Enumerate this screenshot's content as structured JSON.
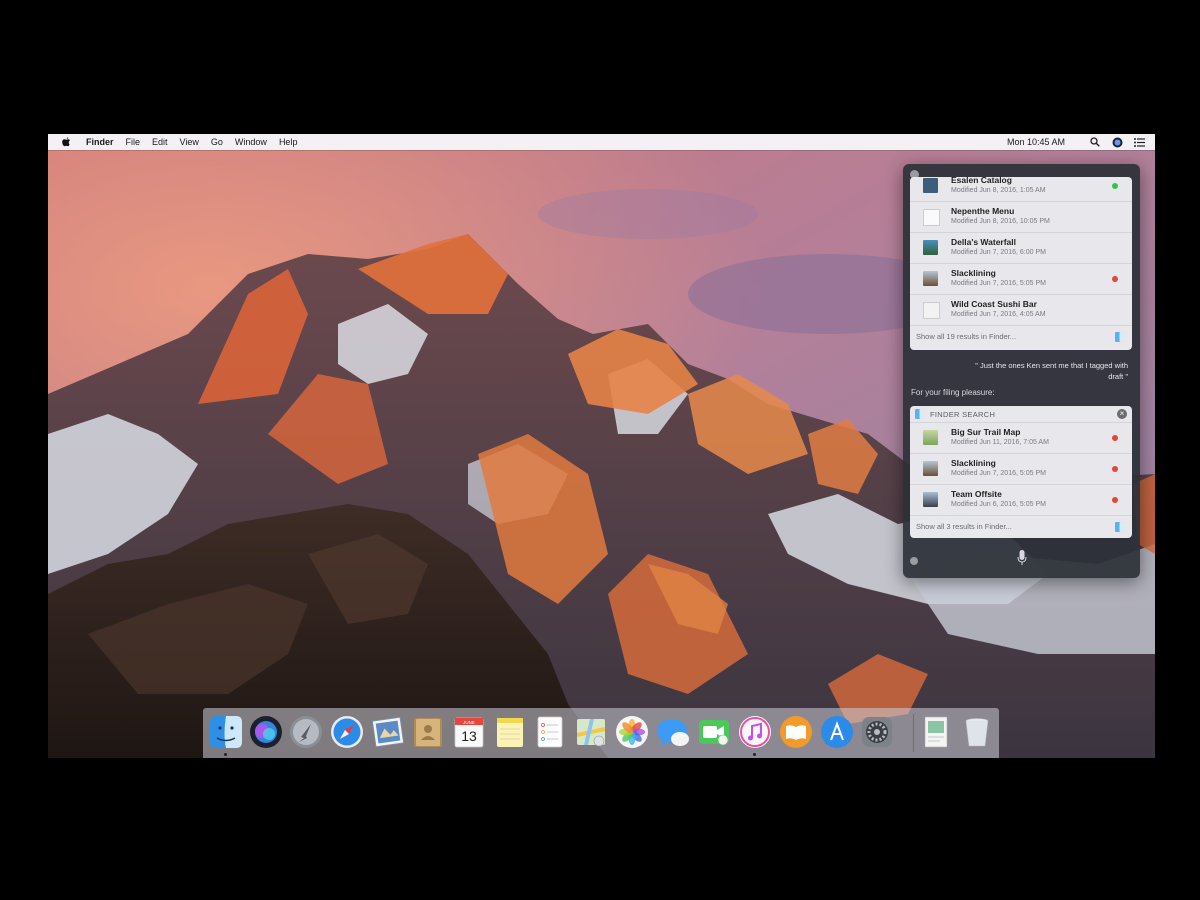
{
  "menubar": {
    "items": [
      "Finder",
      "File",
      "Edit",
      "View",
      "Go",
      "Window",
      "Help"
    ],
    "clock": "Mon 10:45 AM"
  },
  "siri": {
    "recent_results": [
      {
        "name": "Esalen Catalog",
        "modified": "Modified Jun 8, 2016, 1:05 AM",
        "tag_color": "#35c14b"
      },
      {
        "name": "Nepenthe Menu",
        "modified": "Modified Jun 8, 2016, 10:05 PM",
        "tag_color": ""
      },
      {
        "name": "Della's Waterfall",
        "modified": "Modified Jun 7, 2016, 6:00 PM",
        "tag_color": ""
      },
      {
        "name": "Slacklining",
        "modified": "Modified Jun 7, 2016, 5:05 PM",
        "tag_color": "#e2453c"
      },
      {
        "name": "Wild Coast Sushi Bar",
        "modified": "Modified Jun 7, 2016, 4:05 AM",
        "tag_color": ""
      }
    ],
    "show_all_first": "Show all 19 results in Finder...",
    "user_query": "\" Just the ones Ken sent me that I tagged with draft \"",
    "answer": "For your filing pleasure:",
    "finder_search_label": "FINDER SEARCH",
    "filtered_results": [
      {
        "name": "Big Sur Trail Map",
        "modified": "Modified Jun 11, 2016, 7:05 AM",
        "tag_color": "#e2453c"
      },
      {
        "name": "Slacklining",
        "modified": "Modified Jun 7, 2016, 5:05 PM",
        "tag_color": "#e2453c"
      },
      {
        "name": "Team Offsite",
        "modified": "Modified Jun 6, 2016, 5:05 PM",
        "tag_color": "#e2453c"
      }
    ],
    "show_all_second": "Show all 3 results in Finder..."
  },
  "dock": {
    "apps": [
      "finder-icon",
      "siri-icon",
      "launchpad-icon",
      "safari-icon",
      "mail-icon",
      "contacts-icon",
      "calendar-icon",
      "notes-icon",
      "reminders-icon",
      "maps-icon",
      "photos-icon",
      "messages-icon",
      "facetime-icon",
      "itunes-icon",
      "ibooks-icon",
      "app-store-icon",
      "system-preferences-icon",
      "document-icon",
      "trash-icon"
    ],
    "calendar_day": "13",
    "calendar_month": "JUNE"
  },
  "colors": {
    "panel_bg": "#2c3038",
    "tag_red": "#e2453c",
    "tag_green": "#35c14b",
    "menubar_bg": "#f3f1f4"
  }
}
